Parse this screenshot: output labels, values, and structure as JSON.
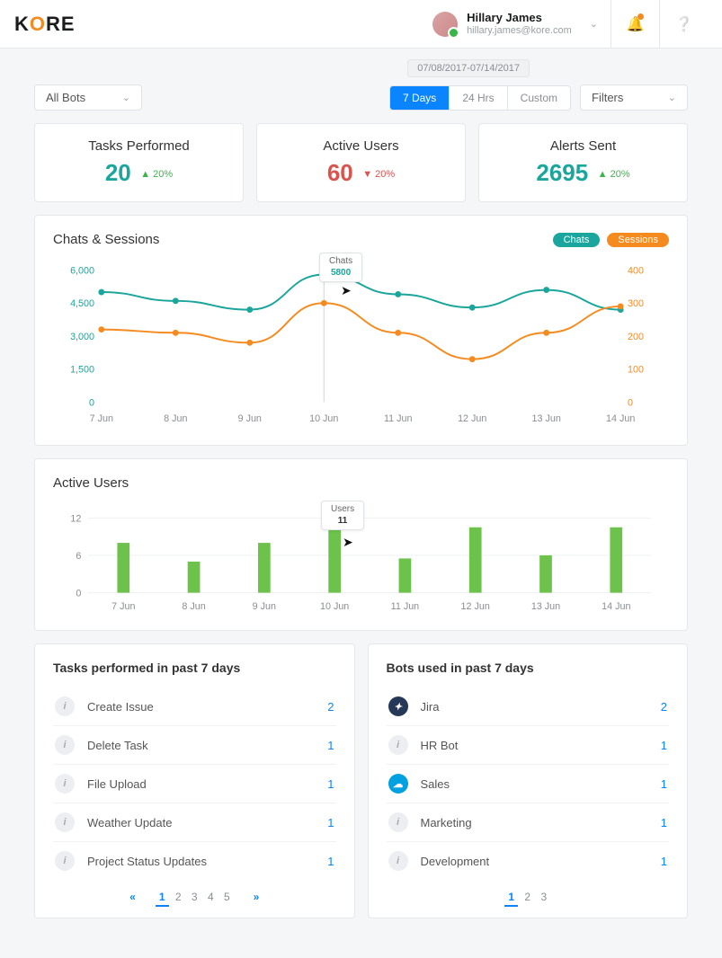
{
  "brand": {
    "text_k": "K",
    "text_ore": "RE",
    "orange": "O"
  },
  "user": {
    "name": "Hillary James",
    "email": "hillary.james@kore.com"
  },
  "date_range": "07/08/2017-07/14/2017",
  "filters_label": "Filters",
  "bot_selector": "All Bots",
  "time_seg": {
    "d7": "7 Days",
    "h24": "24 Hrs",
    "custom": "Custom"
  },
  "kpis": {
    "tasks": {
      "label": "Tasks Performed",
      "value": "20",
      "delta": "20%",
      "dir": "up"
    },
    "users": {
      "label": "Active Users",
      "value": "60",
      "delta": "20%",
      "dir": "dn"
    },
    "alerts": {
      "label": "Alerts Sent",
      "value": "2695",
      "delta": "20%",
      "dir": "up"
    }
  },
  "chats_sessions": {
    "title": "Chats & Sessions",
    "pill_chats": "Chats",
    "pill_sessions": "Sessions",
    "tooltip_title": "Chats",
    "tooltip_value": "5800"
  },
  "active_users": {
    "title": "Active Users",
    "tooltip_title": "Users",
    "tooltip_value": "11"
  },
  "tasks_list": {
    "title": "Tasks performed in past 7 days",
    "items": [
      {
        "label": "Create Issue",
        "count": "2"
      },
      {
        "label": "Delete Task",
        "count": "1"
      },
      {
        "label": "File Upload",
        "count": "1"
      },
      {
        "label": "Weather Update",
        "count": "1"
      },
      {
        "label": "Project Status Updates",
        "count": "1"
      }
    ],
    "pages": [
      "1",
      "2",
      "3",
      "4",
      "5"
    ]
  },
  "bots_list": {
    "title": "Bots used in past 7 days",
    "items": [
      {
        "label": "Jira",
        "count": "2",
        "icon": "jira"
      },
      {
        "label": "HR Bot",
        "count": "1",
        "icon": "info"
      },
      {
        "label": "Sales",
        "count": "1",
        "icon": "sales"
      },
      {
        "label": "Marketing",
        "count": "1",
        "icon": "info"
      },
      {
        "label": "Development",
        "count": "1",
        "icon": "info"
      }
    ],
    "pages": [
      "1",
      "2",
      "3"
    ]
  },
  "chart_data": [
    {
      "type": "line",
      "title": "Chats & Sessions",
      "categories": [
        "7 Jun",
        "8 Jun",
        "9 Jun",
        "10 Jun",
        "11 Jun",
        "12 Jun",
        "13 Jun",
        "14 Jun"
      ],
      "series": [
        {
          "name": "Chats",
          "values": [
            5000,
            4600,
            4200,
            5800,
            4900,
            4300,
            5100,
            4200
          ],
          "axis": "left",
          "color": "#1aa59d"
        },
        {
          "name": "Sessions",
          "values": [
            220,
            210,
            180,
            300,
            210,
            130,
            210,
            290
          ],
          "axis": "right",
          "color": "#f58b1f"
        }
      ],
      "ylabel_left": "",
      "ylim_left": [
        0,
        6000
      ],
      "yticks_left": [
        0,
        1500,
        3000,
        4500,
        6000
      ],
      "ylabel_right": "",
      "ylim_right": [
        0,
        400
      ],
      "yticks_right": [
        0,
        100,
        200,
        300,
        400
      ]
    },
    {
      "type": "bar",
      "title": "Active Users",
      "categories": [
        "7 Jun",
        "8 Jun",
        "9 Jun",
        "10 Jun",
        "11 Jun",
        "12 Jun",
        "13 Jun",
        "14 Jun"
      ],
      "values": [
        8,
        5,
        8,
        11,
        5.5,
        10.5,
        6,
        10.5
      ],
      "ylabel": "",
      "ylim": [
        0,
        12
      ],
      "yticks": [
        0,
        6,
        12
      ],
      "color": "#6cc24a"
    }
  ]
}
